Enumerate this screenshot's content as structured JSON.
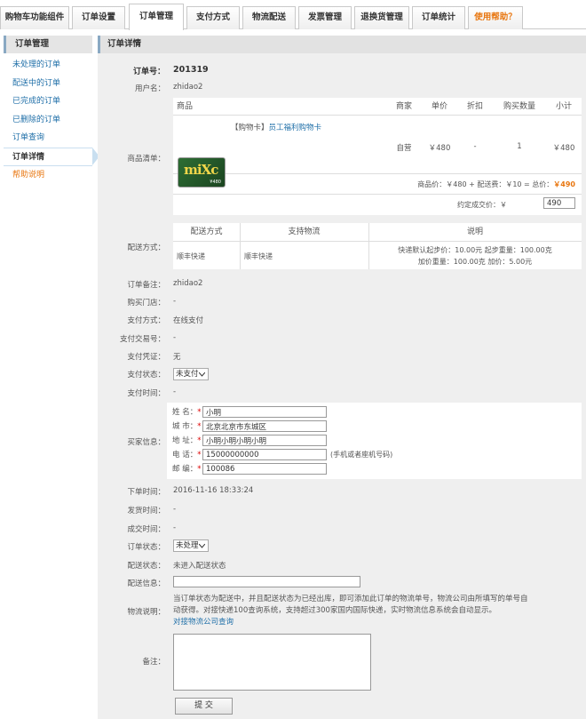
{
  "tabs": [
    {
      "label": "购物车功能组件"
    },
    {
      "label": "订单设置"
    },
    {
      "label": "订单管理"
    },
    {
      "label": "支付方式"
    },
    {
      "label": "物流配送"
    },
    {
      "label": "发票管理"
    },
    {
      "label": "退换货管理"
    },
    {
      "label": "订单统计"
    },
    {
      "label": "使用帮助？"
    }
  ],
  "sidebar": {
    "title": "订单管理",
    "items": [
      {
        "label": "未处理的订单"
      },
      {
        "label": "配送中的订单"
      },
      {
        "label": "已完成的订单"
      },
      {
        "label": "已删除的订单"
      },
      {
        "label": "订单查询"
      },
      {
        "label": "订单详情"
      },
      {
        "label": "帮助说明"
      }
    ]
  },
  "main": {
    "title": "订单详情",
    "order_no_label": "订单号：",
    "order_no": "201319",
    "username_label": "用户名：",
    "username": "zhidao2",
    "goods_label": "商品清单：",
    "goods_headers": [
      "商品",
      "商家",
      "单价",
      "折扣",
      "购买数量",
      "小计"
    ],
    "goods": {
      "tag": "【购物卡】",
      "name": "员工福利购物卡",
      "seller": "自营",
      "price": "￥480",
      "discount": "-",
      "qty": "1",
      "subtotal": "￥480",
      "card_logo": "miXc",
      "card_sub": "¥480"
    },
    "total_text": "商品价：￥480 + 配送费：￥10 = 总价：",
    "total_value": "￥490",
    "deal_price_label": "约定成交价：￥",
    "deal_price": "490",
    "shipping_label": "配送方式：",
    "shipping_headers": [
      "配送方式",
      "支持物流",
      "说明"
    ],
    "shipping": {
      "method": "顺丰快递",
      "logistics": "顺丰快递",
      "desc_line1": "快递默认起步价：10.00元   起步重量：100.00克",
      "desc_line2": "加价重量：100.00克   加价：5.00元"
    },
    "remark_label": "订单备注：",
    "remark": "zhidao2",
    "store_label": "购买门店：",
    "store": "-",
    "pay_method_label": "支付方式：",
    "pay_method": "在线支付",
    "pay_txn_label": "支付交易号：",
    "pay_txn": "-",
    "pay_voucher_label": "支付凭证：",
    "pay_voucher": "无",
    "pay_status_label": "支付状态：",
    "pay_status": "未支付",
    "pay_time_label": "支付时间：",
    "pay_time": "-",
    "buyer_label": "买家信息：",
    "buyer": {
      "name_label": "姓 名：",
      "name": "小明",
      "city_label": "城 市：",
      "city": "北京北京市东城区",
      "address_label": "地 址：",
      "address": "小明小明小明小明",
      "phone_label": "电 话：",
      "phone": "15000000000",
      "phone_hint": "(手机或者座机号码)",
      "zip_label": "邮 编：",
      "zip": "100086"
    },
    "order_time_label": "下单时间：",
    "order_time": "2016-11-16 18:33:24",
    "ship_time_label": "发货时间：",
    "ship_time": "-",
    "deal_time_label": "成交时间：",
    "deal_time": "-",
    "order_status_label": "订单状态：",
    "order_status": "未处理",
    "delivery_status_label": "配送状态：",
    "delivery_status": "未进入配送状态",
    "delivery_info_label": "配送信息：",
    "logistics_desc_label": "物流说明：",
    "logistics_desc_line1": "当订单状态为配送中，并且配送状态为已经出库，即可添加此订单的物流单号，物流公司由所填写的单号自",
    "logistics_desc_line2": "动获得。对接快递100查询系统，支持超过300家国内国际快递，实时物流信息系统会自动显示。",
    "logistics_link": "对接物流公司查询",
    "note_label": "备注：",
    "submit": "提 交"
  }
}
